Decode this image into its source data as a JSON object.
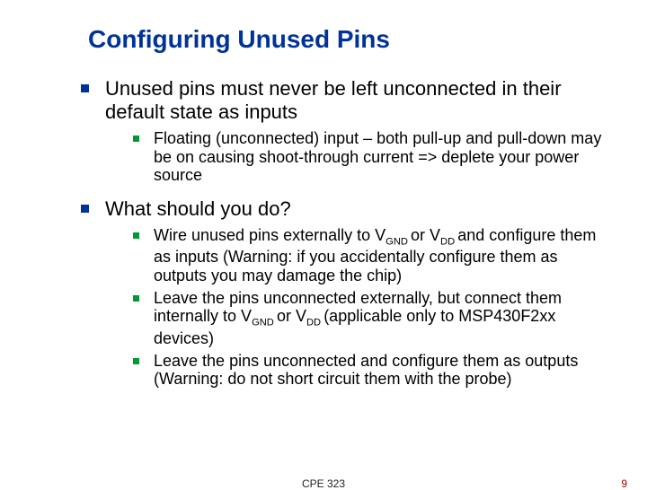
{
  "title": "Configuring Unused Pins",
  "l1": {
    "a": "Unused pins must never be left unconnected in their default state as inputs",
    "b": "What should you do?"
  },
  "l2": {
    "a1": "Floating (unconnected) input – both pull-up and pull-down may be on causing shoot-through current => deplete your power source",
    "b1_pre": "Wire unused pins externally to V",
    "b1_gnd": "GND ",
    "b1_mid": "or V",
    "b1_dd": "DD ",
    "b1_post": "and configure them as inputs (Warning: if you accidentally configure them as outputs you may damage the chip)",
    "b2_pre": "Leave the pins unconnected externally, but connect them internally to V",
    "b2_gnd": "GND ",
    "b2_mid": "or V",
    "b2_dd": "DD ",
    "b2_post": "(applicable only to MSP430F2xx devices)",
    "b3": "Leave the pins unconnected and configure them as outputs (Warning: do not short circuit them with the probe)"
  },
  "footer": {
    "center": "CPE 323",
    "right": "9"
  }
}
